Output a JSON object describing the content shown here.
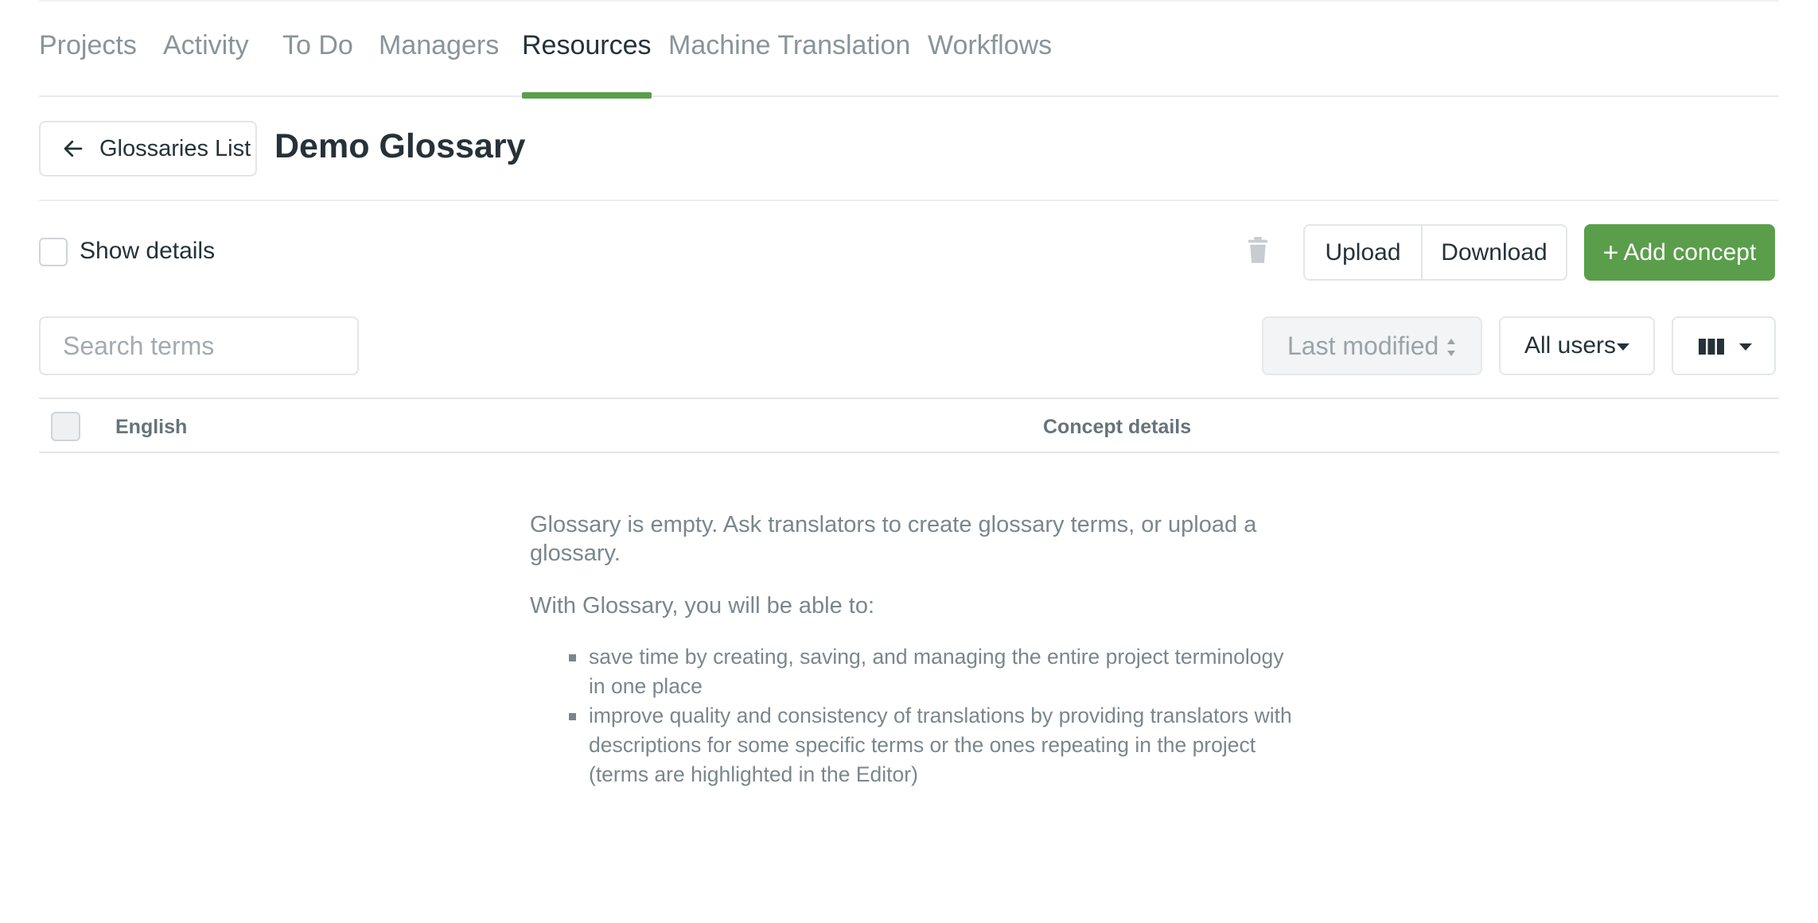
{
  "tabs": [
    {
      "label": "Projects",
      "active": false
    },
    {
      "label": "Activity",
      "active": false
    },
    {
      "label": "To Do",
      "active": false
    },
    {
      "label": "Managers",
      "active": false
    },
    {
      "label": "Resources",
      "active": true
    },
    {
      "label": "Machine Translation",
      "active": false
    },
    {
      "label": "Workflows",
      "active": false
    }
  ],
  "header": {
    "back_label": "Glossaries List",
    "title": "Demo Glossary"
  },
  "toolbar": {
    "show_details_label": "Show details",
    "show_details_checked": false,
    "upload_label": "Upload",
    "download_label": "Download",
    "add_concept_label": "Add concept"
  },
  "filters": {
    "search_placeholder": "Search terms",
    "sort_label": "Last modified",
    "users_label": "All users"
  },
  "table": {
    "columns": [
      "English",
      "Concept details"
    ]
  },
  "empty_state": {
    "message": "Glossary is empty. Ask translators to create glossary terms, or upload a glossary.",
    "intro": "With Glossary, you will be able to:",
    "bullets": [
      "save time by creating, saving, and managing the entire project terminology in one place",
      "improve quality and consistency of translations by providing translators with descriptions for some specific terms or the ones repeating in the project (terms are highlighted in the Editor)"
    ]
  },
  "colors": {
    "accent": "#5a9e4b",
    "text": "#263238",
    "muted": "#8a9499"
  }
}
